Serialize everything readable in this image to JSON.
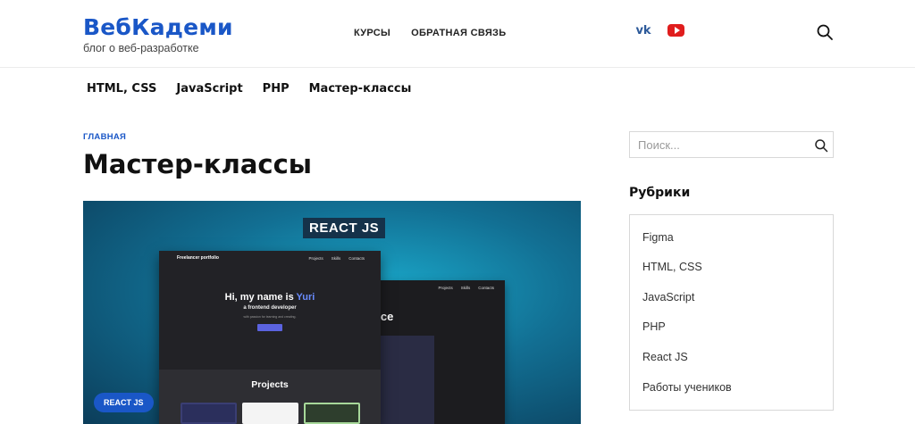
{
  "brand": {
    "name": "ВебКадеми",
    "tagline": "блог о веб-разработке"
  },
  "top_nav": [
    "КУРСЫ",
    "ОБРАТНАЯ СВЯЗЬ"
  ],
  "social": {
    "vk": "vk-icon",
    "youtube": "youtube-icon"
  },
  "category_nav": [
    "HTML, CSS",
    "JavaScript",
    "PHP",
    "Мастер-классы"
  ],
  "breadcrumb": "ГЛАВНАЯ",
  "page_title": "Мастер-классы",
  "hero": {
    "badge": "REACT JS",
    "mock_logo": "Freelancer portfolio",
    "mock_nav": [
      "Projects",
      "Skills",
      "Contacts"
    ],
    "greeting": "Hi, my name is ",
    "greeting_name": "Yuri",
    "role": "a frontend developer",
    "blurb": "with passion for learning and creating.",
    "section_word": "vice",
    "projects_title": "Projects",
    "tag": "REACT JS"
  },
  "sidebar": {
    "search_placeholder": "Поиск...",
    "heading": "Рубрики",
    "categories": [
      "Figma",
      "HTML, CSS",
      "JavaScript",
      "PHP",
      "React JS",
      "Работы учеников"
    ]
  },
  "colors": {
    "accent": "#1a57c7",
    "youtube": "#e01d1d"
  }
}
